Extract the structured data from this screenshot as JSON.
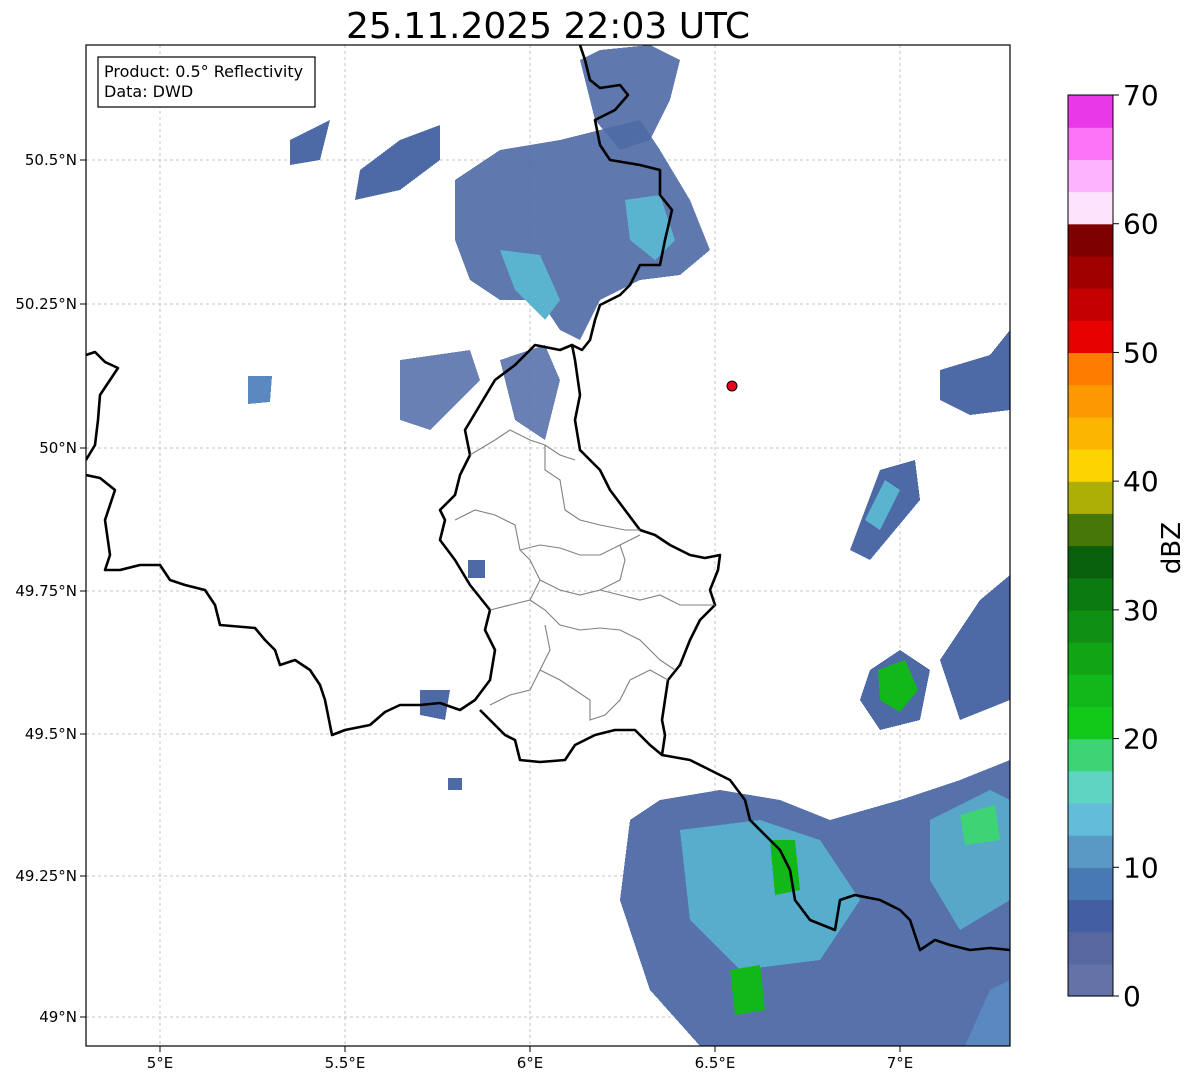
{
  "title": "25.11.2025 22:03 UTC",
  "info_box": {
    "line1": "Product: 0.5° Reflectivity",
    "line2": "Data: DWD"
  },
  "map": {
    "x_ticks": [
      "5°E",
      "5.5°E",
      "6°E",
      "6.5°E",
      "7°E"
    ],
    "y_ticks": [
      "50.5°N",
      "50.25°N",
      "50°N",
      "49.75°N",
      "49.5°N",
      "49.25°N",
      "49°N"
    ],
    "extent": {
      "lon": [
        4.8,
        7.3
      ],
      "lat": [
        48.95,
        50.7
      ]
    },
    "radar_site": {
      "lon": 6.547,
      "lat": 50.109,
      "color": "#e8001c"
    }
  },
  "colorbar": {
    "label": "dBZ",
    "range": [
      0,
      70
    ],
    "tick_labels": [
      "0",
      "10",
      "20",
      "30",
      "40",
      "50",
      "60",
      "70"
    ],
    "colors": [
      "#6572a8",
      "#56689f",
      "#445ea3",
      "#4879b3",
      "#5a98c6",
      "#63bcd9",
      "#5ed4c2",
      "#3cd474",
      "#12c818",
      "#12b81a",
      "#11a414",
      "#0f8f13",
      "#0b7a10",
      "#08600c",
      "#467708",
      "#acaf06",
      "#fcd500",
      "#fcb500",
      "#fd9900",
      "#fe7c00",
      "#e60000",
      "#c40000",
      "#a00000",
      "#7f0000",
      "#fee3fd",
      "#fdb3fd",
      "#fd74f6",
      "#e938e8"
    ]
  }
}
